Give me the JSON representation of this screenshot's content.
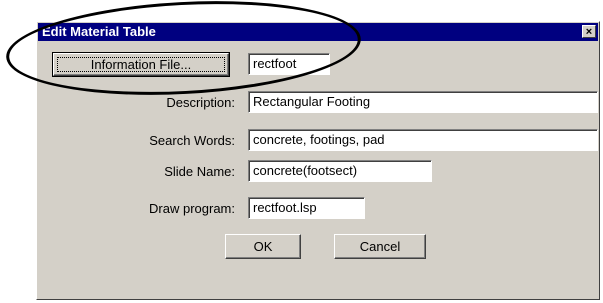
{
  "window": {
    "title": "Edit Material Table",
    "close_glyph": "×"
  },
  "buttons": {
    "information_file": "Information File...",
    "ok": "OK",
    "cancel": "Cancel"
  },
  "fields": {
    "file_name": {
      "value": "rectfoot"
    },
    "description": {
      "label": "Description:",
      "value": "Rectangular Footing"
    },
    "search_words": {
      "label": "Search Words:",
      "value": "concrete, footings, pad"
    },
    "slide_name": {
      "label": "Slide Name:",
      "value": "concrete(footsect)"
    },
    "draw_program": {
      "label": "Draw program:",
      "value": "rectfoot.lsp"
    }
  },
  "colors": {
    "titlebar": "#000080",
    "dialog_face": "#d4d0c8",
    "annotation": "#000000"
  },
  "icons": {
    "close": "close-icon"
  }
}
